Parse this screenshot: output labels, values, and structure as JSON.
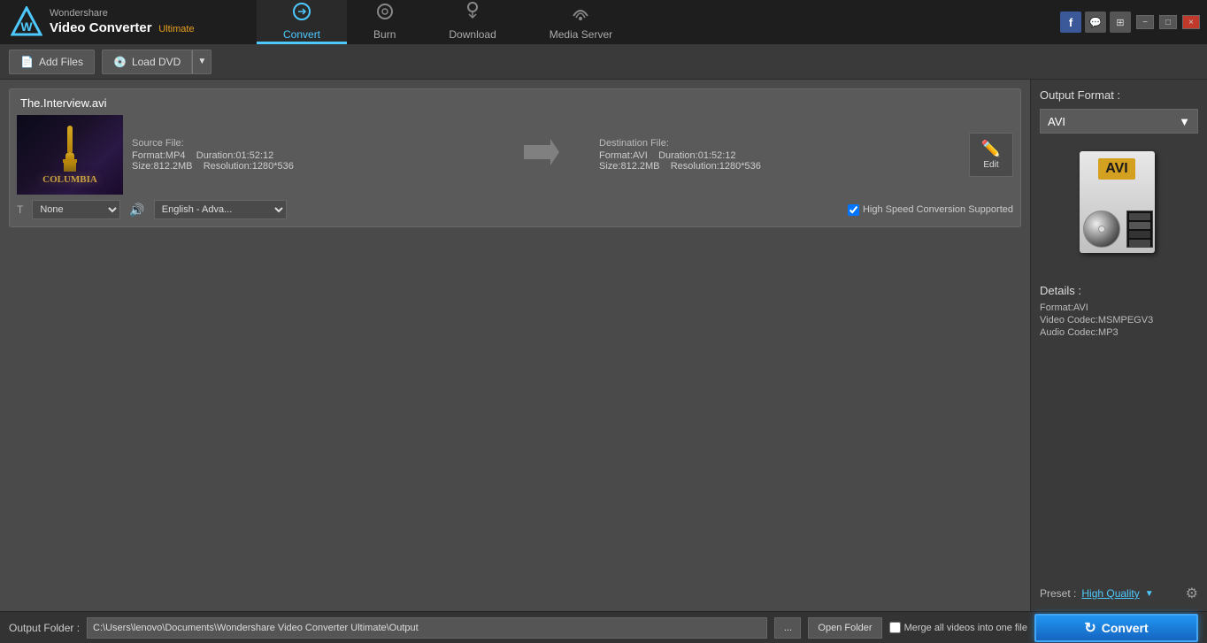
{
  "app": {
    "name_line1": "Wondershare",
    "name_line2": "Video Converter",
    "edition": "Ultimate"
  },
  "nav": {
    "tabs": [
      {
        "id": "convert",
        "label": "Convert",
        "active": true
      },
      {
        "id": "burn",
        "label": "Burn",
        "active": false
      },
      {
        "id": "download",
        "label": "Download",
        "active": false
      },
      {
        "id": "media_server",
        "label": "Media Server",
        "active": false
      }
    ]
  },
  "toolbar": {
    "add_files_label": "Add Files",
    "load_dvd_label": "Load DVD"
  },
  "file_item": {
    "filename": "The.Interview.avi",
    "source": {
      "label": "Source File:",
      "format_label": "Format:",
      "format_value": "MP4",
      "duration_label": "Duration:",
      "duration_value": "01:52:12",
      "size_label": "Size:",
      "size_value": "812.2MB",
      "resolution_label": "Resolution:",
      "resolution_value": "1280*536"
    },
    "destination": {
      "label": "Destination File:",
      "format_label": "Format:",
      "format_value": "AVI",
      "duration_label": "Duration:",
      "duration_value": "01:52:12",
      "size_label": "Size:",
      "size_value": "812.2MB",
      "resolution_label": "Resolution:",
      "resolution_value": "1280*536"
    },
    "subtitle_option": "None",
    "audio_option": "English - Adva...",
    "high_speed_label": "High Speed Conversion Supported",
    "edit_btn_label": "Edit"
  },
  "right_panel": {
    "output_format_label": "Output Format :",
    "format_value": "AVI",
    "details_label": "Details :",
    "format_detail": "Format:AVI",
    "video_codec_detail": "Video Codec:MSMPEGV3",
    "audio_codec_detail": "Audio Codec:MP3",
    "preset_label": "Preset :",
    "preset_value": "High Quality"
  },
  "bottom_bar": {
    "output_folder_label": "Output Folder :",
    "output_path": "C:\\Users\\lenovo\\Documents\\Wondershare Video Converter Ultimate\\Output",
    "browse_label": "...",
    "open_folder_label": "Open Folder",
    "merge_label": "Merge all videos into one file",
    "convert_label": "Convert"
  },
  "title_bar_controls": {
    "minimize": "−",
    "restore": "□",
    "close": "×"
  }
}
